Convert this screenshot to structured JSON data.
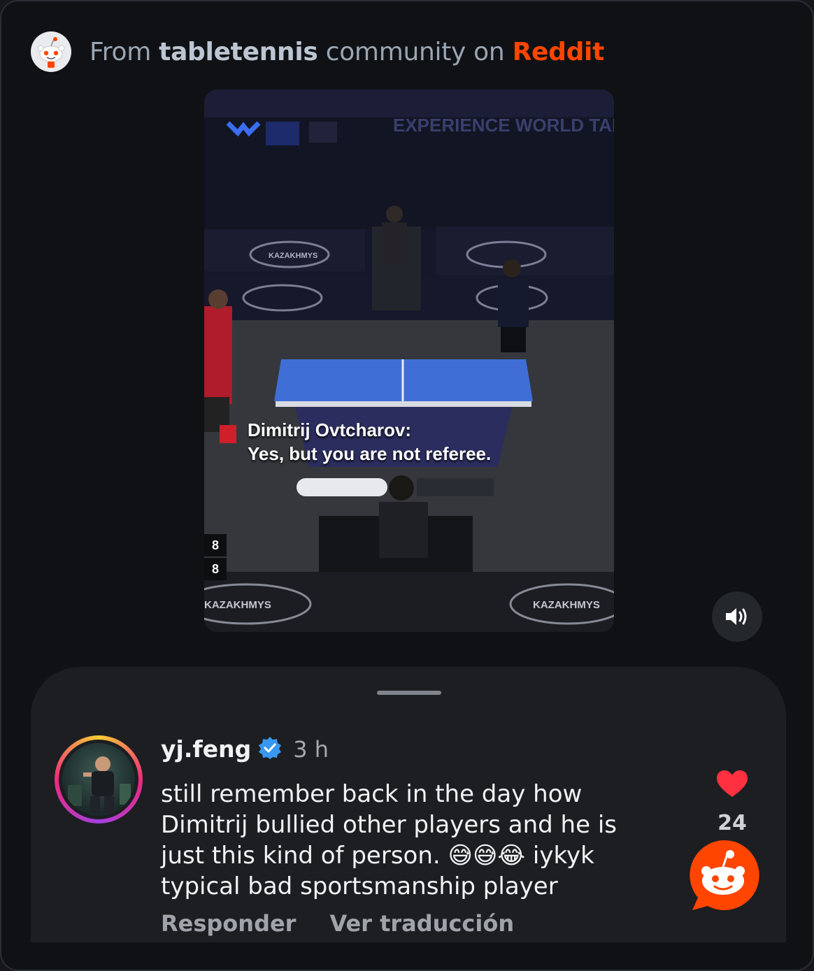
{
  "header": {
    "prefix": "From",
    "community": "tabletennis",
    "middle": "community on",
    "platform": "Reddit",
    "icon": "reddit-snoo-icon"
  },
  "video": {
    "caption_line1": "Dimitrij Ovtcharov:",
    "caption_line2": "Yes, but you are not referee.",
    "banner_text": "EXPERIENCE WORLD TABLE TENNIS",
    "sponsor": "KAZAKHMYS",
    "score_top": "8",
    "score_bottom": "8",
    "sound_icon": "speaker-volume-icon"
  },
  "comment": {
    "username": "yj.feng",
    "verified_icon": "verified-badge-icon",
    "time": "3 h",
    "text": "still remember back in the day how\nDimitrij bullied other players and he is\njust this kind of person. 😅😅😂 iykyk\ntypical bad sportsmanship player",
    "likes": "24",
    "reply_label": "Responder",
    "translate_label": "Ver traducción"
  },
  "colors": {
    "reddit_orange": "#ff4500",
    "like_red": "#ff3040",
    "verified_blue": "#3897f0"
  }
}
